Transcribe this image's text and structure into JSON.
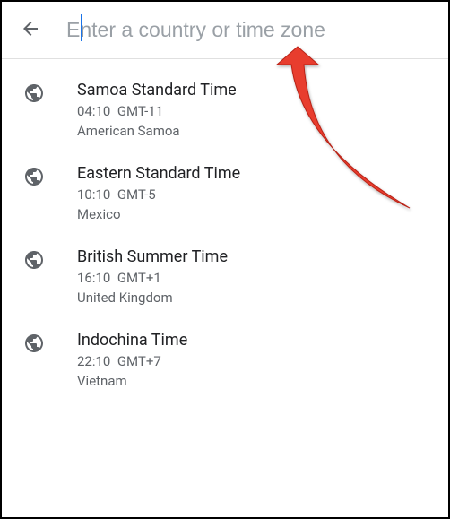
{
  "header": {
    "back_icon": "back-arrow",
    "search_placeholder": "Enter a country or time zone",
    "search_value": ""
  },
  "timezones": [
    {
      "name": "Samoa Standard Time",
      "time": "04:10",
      "offset": "GMT-11",
      "region": "American Samoa"
    },
    {
      "name": "Eastern Standard Time",
      "time": "10:10",
      "offset": "GMT-5",
      "region": "Mexico"
    },
    {
      "name": "British Summer Time",
      "time": "16:10",
      "offset": "GMT+1",
      "region": "United Kingdom"
    },
    {
      "name": "Indochina Time",
      "time": "22:10",
      "offset": "GMT+7",
      "region": "Vietnam"
    }
  ]
}
